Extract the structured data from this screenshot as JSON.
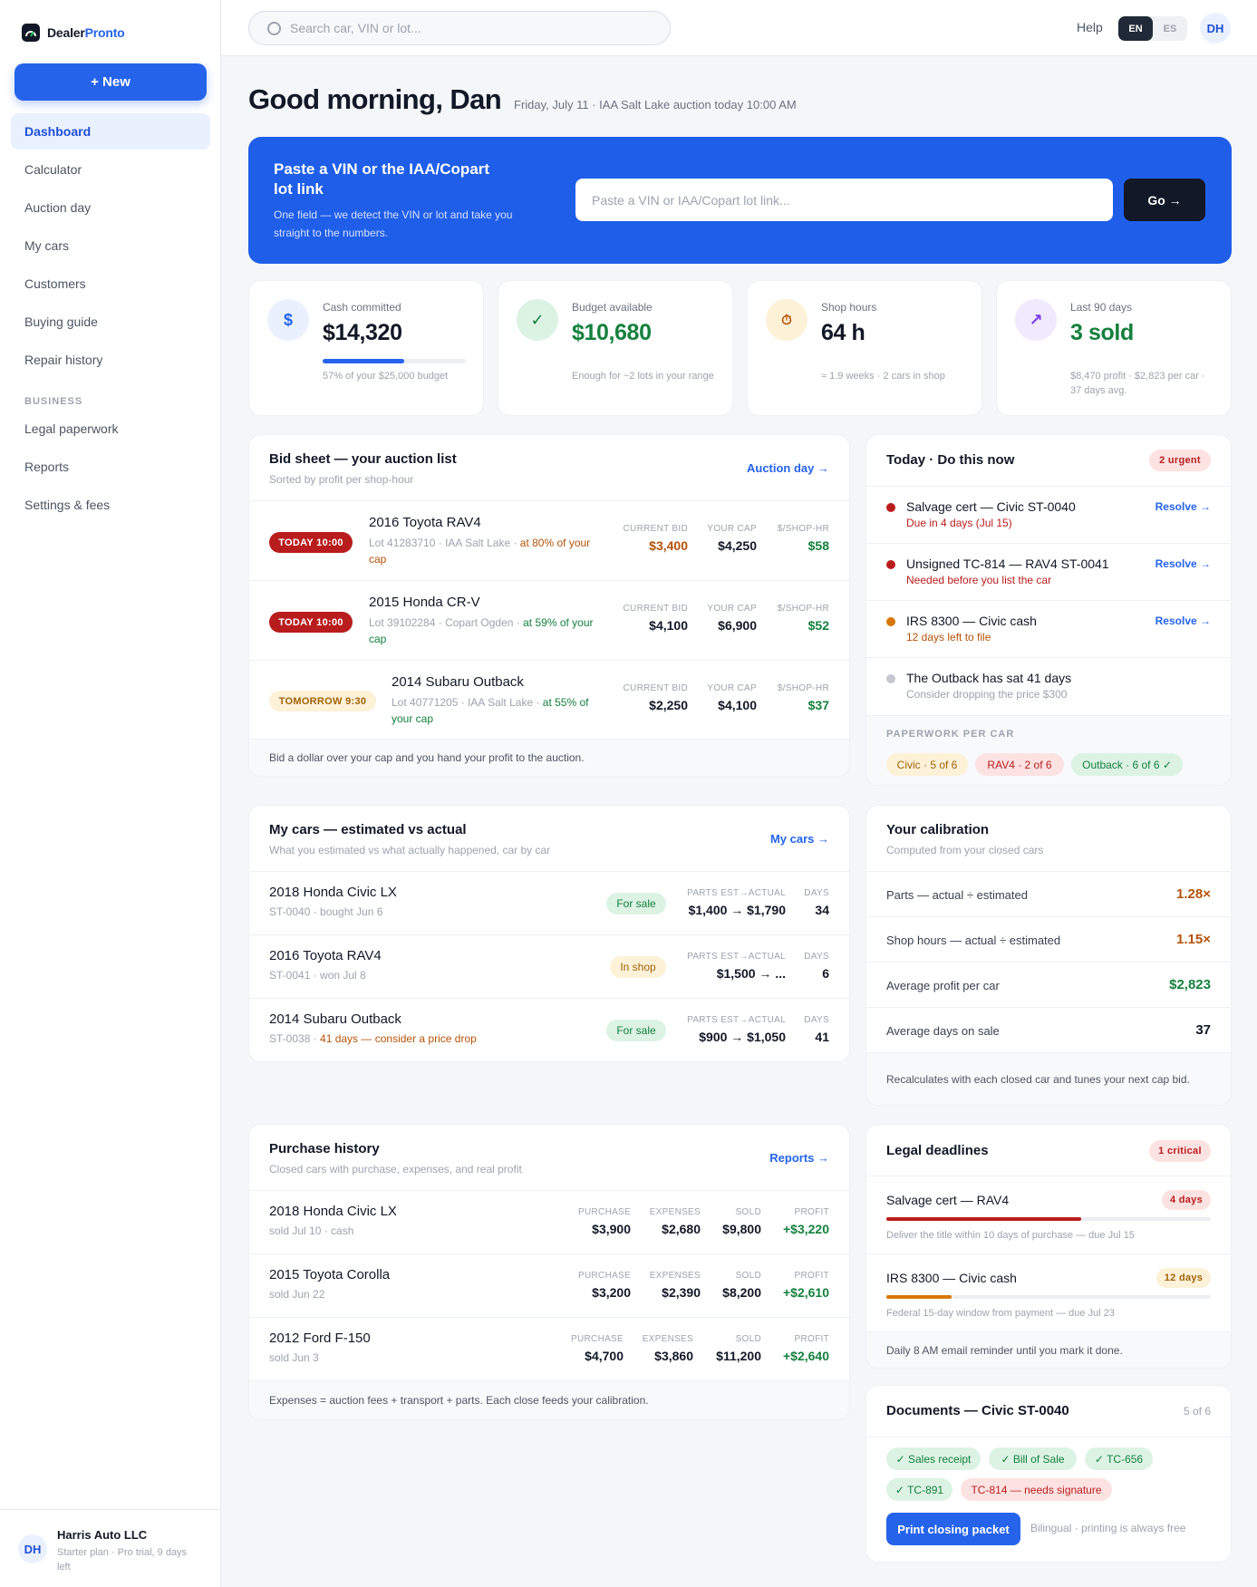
{
  "brand": {
    "name_dark": "Dealer",
    "name_accent": "Pronto"
  },
  "sidebar": {
    "new_label": "+ New",
    "items": [
      {
        "label": "Dashboard"
      },
      {
        "label": "Calculator"
      },
      {
        "label": "Auction day"
      },
      {
        "label": "My cars"
      },
      {
        "label": "Customers"
      },
      {
        "label": "Buying guide"
      },
      {
        "label": "Repair history"
      }
    ],
    "section_label": "BUSINESS",
    "business_items": [
      {
        "label": "Legal paperwork"
      },
      {
        "label": "Reports"
      },
      {
        "label": "Settings & fees"
      }
    ],
    "account": {
      "initials": "DH",
      "name": "Harris Auto LLC",
      "plan": "Starter plan · Pro trial, 9 days left"
    }
  },
  "topbar": {
    "search_placeholder": "Search car, VIN or lot...",
    "help": "Help",
    "lang_en": "EN",
    "lang_es": "ES",
    "user_initials": "DH"
  },
  "greeting": {
    "title": "Good morning, Dan",
    "subtitle": "Friday, July 11 · IAA Salt Lake auction today 10:00 AM"
  },
  "hero": {
    "title": "Paste a VIN or the IAA/Copart lot link",
    "subtitle": "One field — we detect the VIN or lot and take you straight to the numbers.",
    "placeholder": "Paste a VIN or IAA/Copart lot link...",
    "button": "Go →"
  },
  "stats": [
    {
      "label": "Cash committed",
      "value": "$14,320",
      "note": "57% of your $25,000 budget",
      "progress": 0.57,
      "icon": "$"
    },
    {
      "label": "Budget available",
      "value": "$10,680",
      "note": "Enough for ~2 lots in your range",
      "icon": "✓"
    },
    {
      "label": "Shop hours",
      "value": "64 h",
      "note": "≈ 1.9 weeks · 2 cars in shop",
      "icon": "⏱"
    },
    {
      "label": "Last 90 days",
      "value": "3 sold",
      "note": "$8,470 profit · $2,823 per car · 37 days avg.",
      "icon": "↗"
    }
  ],
  "bid_sheet": {
    "title": "Bid sheet — your auction list",
    "subtitle": "Sorted by profit per shop-hour",
    "link": "Auction day →",
    "col_bid": "CURRENT BID",
    "col_cap": "YOUR CAP",
    "col_rate": "$/SHOP-HR",
    "rows": [
      {
        "when": "TODAY 10:00",
        "name": "2016 Toyota RAV4",
        "lot": "Lot 41283710 · IAA Salt Lake · ",
        "pct": "at 80% of your cap",
        "bid": "$3,400",
        "cap": "$4,250",
        "rate": "$58"
      },
      {
        "when": "TODAY 10:00",
        "name": "2015 Honda CR-V",
        "lot": "Lot 39102284 · Copart Ogden · ",
        "pct": "at 59% of your cap",
        "bid": "$4,100",
        "cap": "$6,900",
        "rate": "$52"
      },
      {
        "when": "TOMORROW 9:30",
        "name": "2014 Subaru Outback",
        "lot": "Lot 40771205 · IAA Salt Lake · ",
        "pct": "at 55% of your cap",
        "bid": "$2,250",
        "cap": "$4,100",
        "rate": "$37"
      }
    ],
    "footer": "Bid a dollar over your cap and you hand your profit to the auction."
  },
  "today": {
    "title": "Today · Do this now",
    "badge": "2 urgent",
    "resolve": "Resolve →",
    "tasks": [
      {
        "title": "Salvage cert — Civic ST-0040",
        "sub": "Due in 4 days (Jul 15)"
      },
      {
        "title": "Unsigned TC-814 — RAV4 ST-0041",
        "sub": "Needed before you list the car"
      },
      {
        "title": "IRS 8300 — Civic cash",
        "sub": "12 days left to file"
      },
      {
        "title": "The Outback has sat 41 days",
        "sub": "Consider dropping the price $300"
      }
    ],
    "paperwork_label": "PAPERWORK PER CAR",
    "chips": [
      "Civic · 5 of 6",
      "RAV4 · 2 of 6",
      "Outback · 6 of 6 ✓"
    ]
  },
  "my_cars": {
    "title": "My cars — estimated vs actual",
    "subtitle": "What you estimated vs what actually happened, car by car",
    "link": "My cars →",
    "col_parts": "PARTS EST→ACTUAL",
    "col_days": "DAYS",
    "rows": [
      {
        "name": "2018 Honda Civic LX",
        "sub": "ST-0040 · bought Jun 6",
        "sub_warn": "",
        "status": "For sale",
        "parts": "$1,400 → $1,790",
        "days": "34"
      },
      {
        "name": "2016 Toyota RAV4",
        "sub": "ST-0041 · won Jul 8",
        "sub_warn": "",
        "status": "In shop",
        "parts": "$1,500 → ...",
        "days": "6"
      },
      {
        "name": "2014 Subaru Outback",
        "sub": "ST-0038 · ",
        "sub_warn": "41 days — consider a price drop",
        "status": "For sale",
        "parts": "$900 → $1,050",
        "days": "41"
      }
    ]
  },
  "calibration": {
    "title": "Your calibration",
    "subtitle": "Computed from your closed cars",
    "rows": [
      {
        "label": "Parts — actual ÷ estimated",
        "value": "1.28×"
      },
      {
        "label": "Shop hours — actual ÷ estimated",
        "value": "1.15×"
      },
      {
        "label": "Average profit per car",
        "value": "$2,823"
      },
      {
        "label": "Average days on sale",
        "value": "37"
      }
    ],
    "footer": "Recalculates with each closed car and tunes your next cap bid."
  },
  "purchase": {
    "title": "Purchase history",
    "subtitle": "Closed cars with purchase, expenses, and real profit",
    "link": "Reports →",
    "col_purchase": "PURCHASE",
    "col_expenses": "EXPENSES",
    "col_sold": "SOLD",
    "col_profit": "PROFIT",
    "rows": [
      {
        "name": "2018 Honda Civic LX",
        "sub": "sold Jul 10 · cash",
        "purchase": "$3,900",
        "expenses": "$2,680",
        "sold": "$9,800",
        "profit": "+$3,220"
      },
      {
        "name": "2015 Toyota Corolla",
        "sub": "sold Jun 22",
        "purchase": "$3,200",
        "expenses": "$2,390",
        "sold": "$8,200",
        "profit": "+$2,610"
      },
      {
        "name": "2012 Ford F-150",
        "sub": "sold Jun 3",
        "purchase": "$4,700",
        "expenses": "$3,860",
        "sold": "$11,200",
        "profit": "+$2,640"
      }
    ],
    "footer": "Expenses = auction fees + transport + parts. Each close feeds your calibration."
  },
  "legal": {
    "title": "Legal deadlines",
    "badge": "1 critical",
    "items": [
      {
        "title": "Salvage cert — RAV4",
        "badge": "4 days",
        "sub": "Deliver the title within 10 days of purchase — due Jul 15",
        "progress": 0.6
      },
      {
        "title": "IRS 8300 — Civic cash",
        "badge": "12 days",
        "sub": "Federal 15-day window from payment — due Jul 23",
        "progress": 0.2
      }
    ],
    "footer": "Daily 8 AM email reminder until you mark it done."
  },
  "documents": {
    "title": "Documents — Civic ST-0040",
    "count": "5 of 6",
    "chips": [
      "✓ Sales receipt",
      "✓ Bill of Sale",
      "✓ TC-656",
      "✓ TC-891",
      "TC-814 — needs signature"
    ],
    "button": "Print closing packet",
    "note": "Bilingual · printing is always free"
  },
  "colors": {
    "accent": "#2563eb",
    "hero": "#1f5ee8",
    "green": "#15803d",
    "amber": "#b45309",
    "red": "#b91c1c"
  }
}
